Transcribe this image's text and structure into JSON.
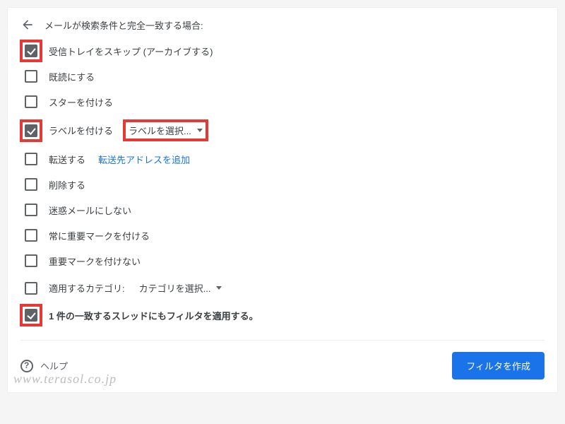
{
  "header": {
    "title": "メールが検索条件と完全一致する場合:"
  },
  "options": [
    {
      "label": "受信トレイをスキップ (アーカイブする)",
      "checked": true,
      "highlighted": true
    },
    {
      "label": "既読にする",
      "checked": false
    },
    {
      "label": "スターを付ける",
      "checked": false
    },
    {
      "label": "ラベルを付ける",
      "checked": true,
      "highlighted": true,
      "dropdown": "ラベルを選択...",
      "dropdown_boxed": true
    },
    {
      "label": "転送する",
      "checked": false,
      "link": "転送先アドレスを追加"
    },
    {
      "label": "削除する",
      "checked": false
    },
    {
      "label": "迷惑メールにしない",
      "checked": false
    },
    {
      "label": "常に重要マークを付ける",
      "checked": false
    },
    {
      "label": "重要マークを付けない",
      "checked": false
    },
    {
      "label": "適用するカテゴリ:",
      "checked": false,
      "dropdown": "カテゴリを選択..."
    },
    {
      "label": "1 件の一致するスレッドにもフィルタを適用する。",
      "checked": true,
      "highlighted": true,
      "bold": true
    }
  ],
  "footer": {
    "help": "ヘルプ",
    "submit": "フィルタを作成"
  },
  "watermark": "www.terasol.co.jp"
}
